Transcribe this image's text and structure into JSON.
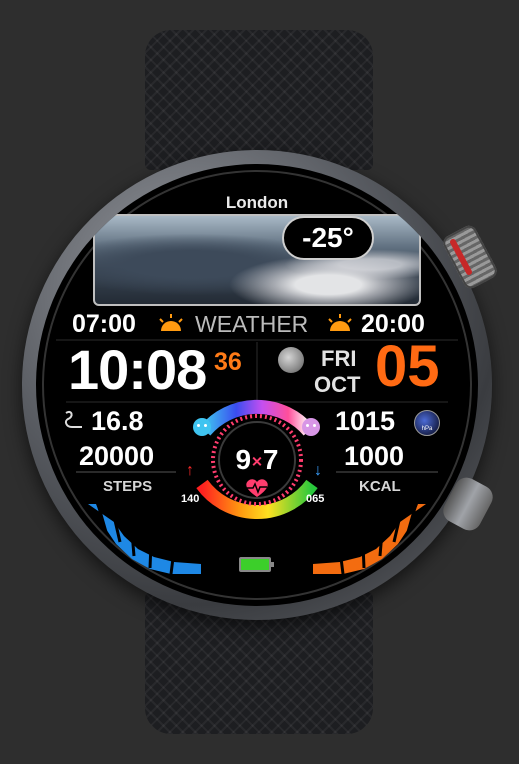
{
  "location": {
    "city": "London"
  },
  "weather": {
    "temperature": "-25°",
    "sunrise": "07:00",
    "sunset": "20:00",
    "label": "WEATHER",
    "sunrise_icon": "sunrise-icon",
    "sunset_icon": "sunset-icon"
  },
  "clock": {
    "hours": "10",
    "colon": ":",
    "minutes": "08",
    "seconds": "36"
  },
  "date": {
    "day_of_week": "FRI",
    "month": "OCT",
    "day": "05",
    "moon_icon": "moon-phase-icon"
  },
  "stats": {
    "distance": "16.8",
    "distance_icon": "walking-distance-icon",
    "pressure": "1015",
    "pressure_unit": "hPa",
    "steps": "20000",
    "steps_label": "STEPS",
    "calories": "1000",
    "calories_label": "KCAL"
  },
  "heart_rate": {
    "value_part1": "9",
    "value_part2": "7",
    "max": "140",
    "min": "065",
    "icon": "heart-rate-icon",
    "max_icon": "arrow-up-icon",
    "min_icon": "arrow-down-icon"
  },
  "battery": {
    "icon": "battery-icon",
    "level": 1.0
  },
  "colors": {
    "accent_orange": "#ff6a13",
    "steps_blue": "#1e88e5",
    "calories_orange": "#f36c10",
    "battery_green": "#3ccf2a",
    "heart_pink": "#ff3d6e"
  }
}
